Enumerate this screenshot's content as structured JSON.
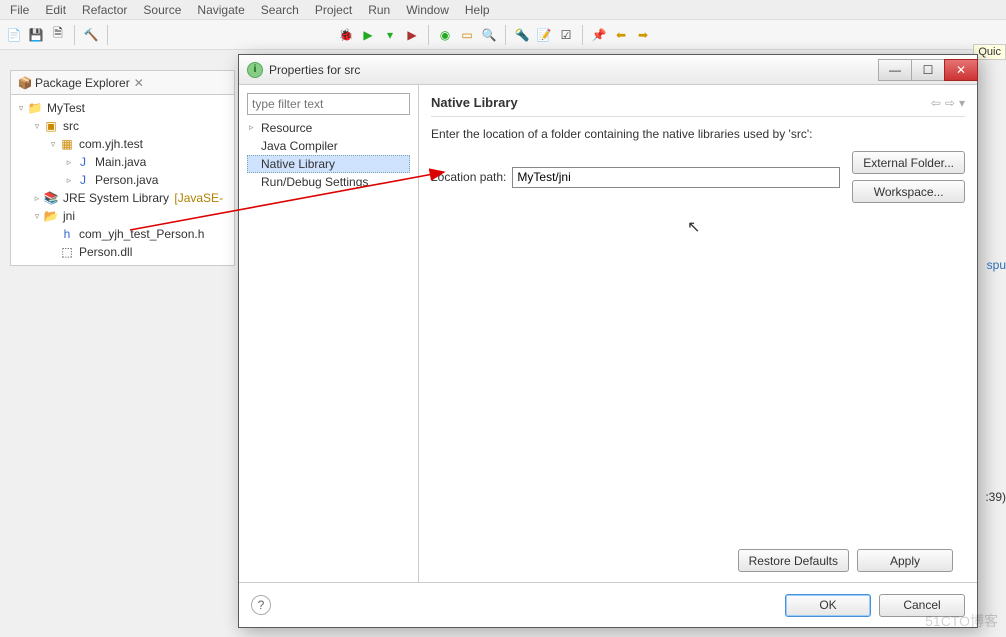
{
  "menu": {
    "items": [
      "File",
      "Edit",
      "Refactor",
      "Source",
      "Navigate",
      "Search",
      "Project",
      "Run",
      "Window",
      "Help"
    ]
  },
  "quick_label": "Quic",
  "explorer": {
    "title": "Package Explorer",
    "project": "MyTest",
    "src": "src",
    "pkg": "com.yjh.test",
    "main": "Main.java",
    "person": "Person.java",
    "jre": "JRE System Library",
    "jre_decor": "[JavaSE-",
    "jni": "jni",
    "header": "com_yjh_test_Person.h",
    "dll": "Person.dll"
  },
  "dialog": {
    "title": "Properties for src",
    "filter_placeholder": "type filter text",
    "cats": {
      "resource": "Resource",
      "javac": "Java Compiler",
      "native": "Native Library",
      "run": "Run/Debug Settings"
    },
    "heading": "Native Library",
    "desc": "Enter the location of a folder containing the native libraries used by 'src':",
    "loc_label": "Location path:",
    "loc_value": "MyTest/jni",
    "btn_ext": "External Folder...",
    "btn_ws": "Workspace...",
    "btn_restore": "Restore Defaults",
    "btn_apply": "Apply",
    "btn_ok": "OK",
    "btn_cancel": "Cancel"
  },
  "side_text1": "spu",
  "side_text2": ":39)",
  "watermark": "51CTO博客"
}
